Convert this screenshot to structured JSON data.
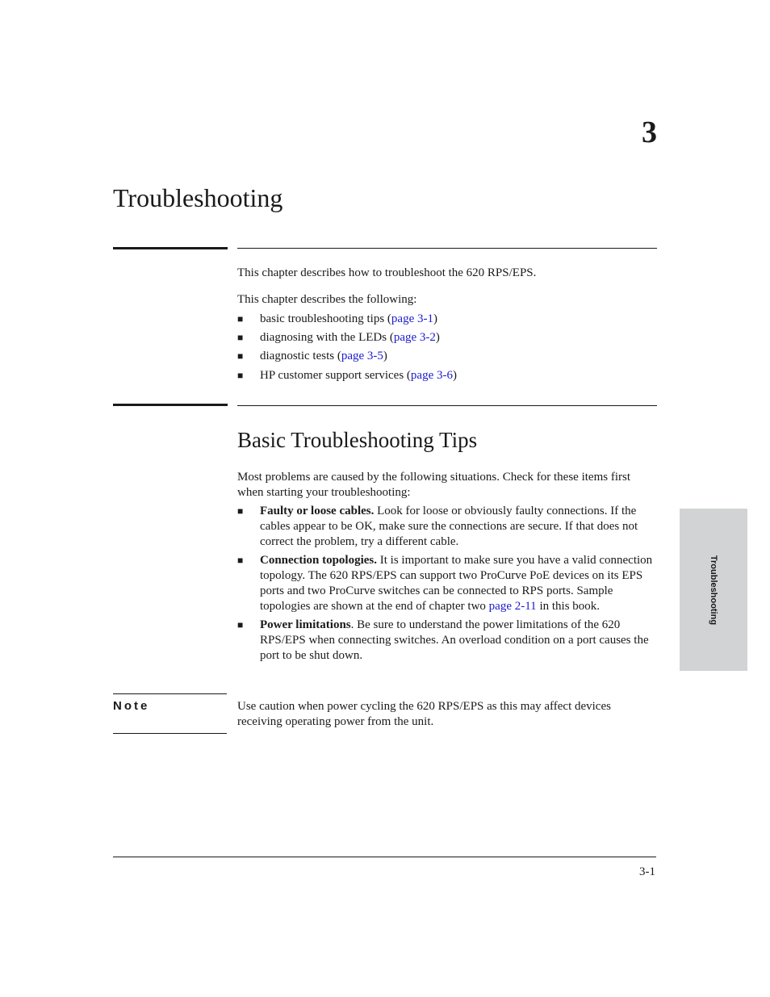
{
  "chapter": {
    "number": "3",
    "title": "Troubleshooting"
  },
  "intro": {
    "paragraph": "This chapter describes how to troubleshoot the 620 RPS/EPS.",
    "list_lead": "This chapter describes the following:",
    "items": [
      {
        "text": "basic troubleshooting tips (",
        "link": "page 3-1",
        "after": ")"
      },
      {
        "text": "diagnosing with the LEDs (",
        "link": "page 3-2",
        "after": ")"
      },
      {
        "text": "diagnostic tests (",
        "link": "page 3-5",
        "after": ")"
      },
      {
        "text": "HP customer support services (",
        "link": "page 3-6",
        "after": ")"
      }
    ]
  },
  "section": {
    "title": "Basic Troubleshooting Tips",
    "intro": "Most problems are caused by the following situations. Check for these items first when starting your troubleshooting:",
    "items": [
      {
        "bold": "Faulty or loose cables.",
        "text": " Look for loose or obviously faulty connections. If the cables appear to be OK, make sure the connections are secure. If that does not correct the problem, try a different cable.",
        "link": "",
        "after": ""
      },
      {
        "bold": "Connection topologies.",
        "text": " It is important to make sure you have a valid connection topology. The 620 RPS/EPS can support two ProCurve PoE devices on its EPS ports and two ProCurve switches can be connected to RPS ports. Sample topologies are shown at the end of chapter two ",
        "link": "page 2-11",
        "after": " in this book."
      },
      {
        "bold": "Power limitations",
        "text": ". Be sure to understand the power limitations of the 620 RPS/EPS when connecting switches. An overload condition on a port causes the port to be shut down.",
        "link": "",
        "after": ""
      }
    ]
  },
  "note": {
    "label": "Note",
    "text": "Use caution when power cycling the 620 RPS/EPS as this may affect devices receiving operating power from the unit."
  },
  "side_tab": {
    "label": "Troubleshooting"
  },
  "footer": {
    "page_number": "3-1"
  },
  "colors": {
    "link": "#1a1acc",
    "side_tab_bg": "#d2d3d4"
  },
  "bullet_glyph": "■"
}
